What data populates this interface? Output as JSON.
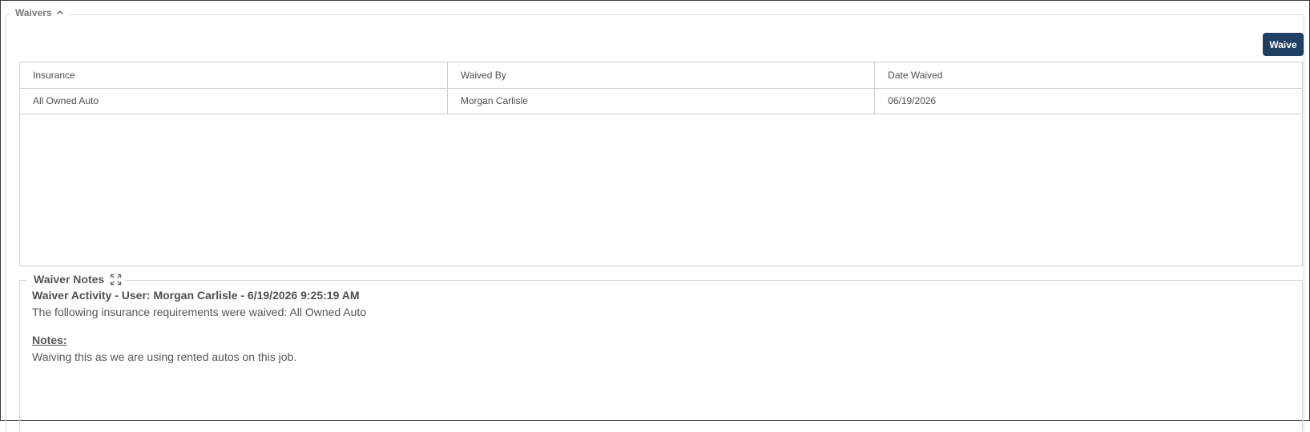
{
  "section": {
    "title": "Waivers",
    "waive_button": "Waive"
  },
  "table": {
    "columns": [
      "Insurance",
      "Waived By",
      "Date Waived"
    ],
    "rows": [
      [
        "All Owned Auto",
        "Morgan Carlisle",
        "06/19/2026"
      ]
    ]
  },
  "notes": {
    "title": "Waiver Notes",
    "activity_title": "Waiver Activity - User: Morgan Carlisle - 6/19/2026 9:25:19 AM",
    "activity_text": "The following insurance requirements were waived: All Owned Auto",
    "notes_heading": "Notes:",
    "notes_text": "Waiving this as we are using rented autos on this job."
  }
}
